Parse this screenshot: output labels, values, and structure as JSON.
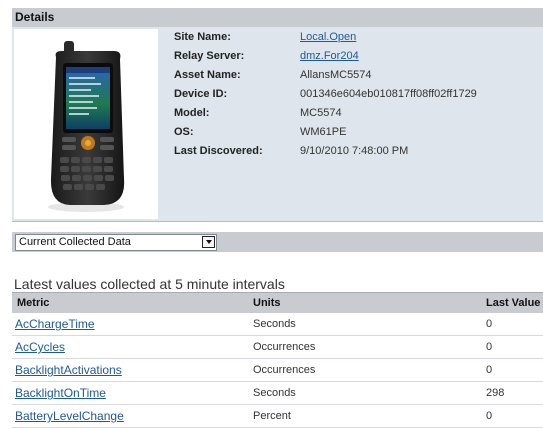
{
  "details": {
    "title": "Details",
    "fields": [
      {
        "label": "Site Name:",
        "value": "Local.Open"
      },
      {
        "label": "Relay Server:",
        "value": "dmz.For204"
      },
      {
        "label": "Asset Name:",
        "value": "AllansMC5574"
      },
      {
        "label": "Device ID:",
        "value": "001346e604eb010817ff08ff02ff1729"
      },
      {
        "label": "Model:",
        "value": "MC5574"
      },
      {
        "label": "OS:",
        "value": "WM61PE"
      },
      {
        "label": "Last Discovered:",
        "value": "9/10/2010 7:48:00 PM"
      }
    ]
  },
  "collect": {
    "select_value": "Current Collected Data",
    "interval_text": "Latest values collected at 5 minute intervals"
  },
  "table": {
    "headers": [
      "Metric",
      "Units",
      "Last Value"
    ],
    "rows": [
      {
        "metric": "AcChargeTime",
        "units": "Seconds",
        "value": "0"
      },
      {
        "metric": "AcCycles",
        "units": "Occurrences",
        "value": "0"
      },
      {
        "metric": "BacklightActivations",
        "units": "Occurrences",
        "value": "0"
      },
      {
        "metric": "BacklightOnTime",
        "units": "Seconds",
        "value": "298"
      },
      {
        "metric": "BatteryLevelChange",
        "units": "Percent",
        "value": "0"
      }
    ]
  },
  "colors": {
    "link": "#1f5a96",
    "header_bg": "#c8cbd0",
    "panel_bg": "#dfe5ec"
  }
}
